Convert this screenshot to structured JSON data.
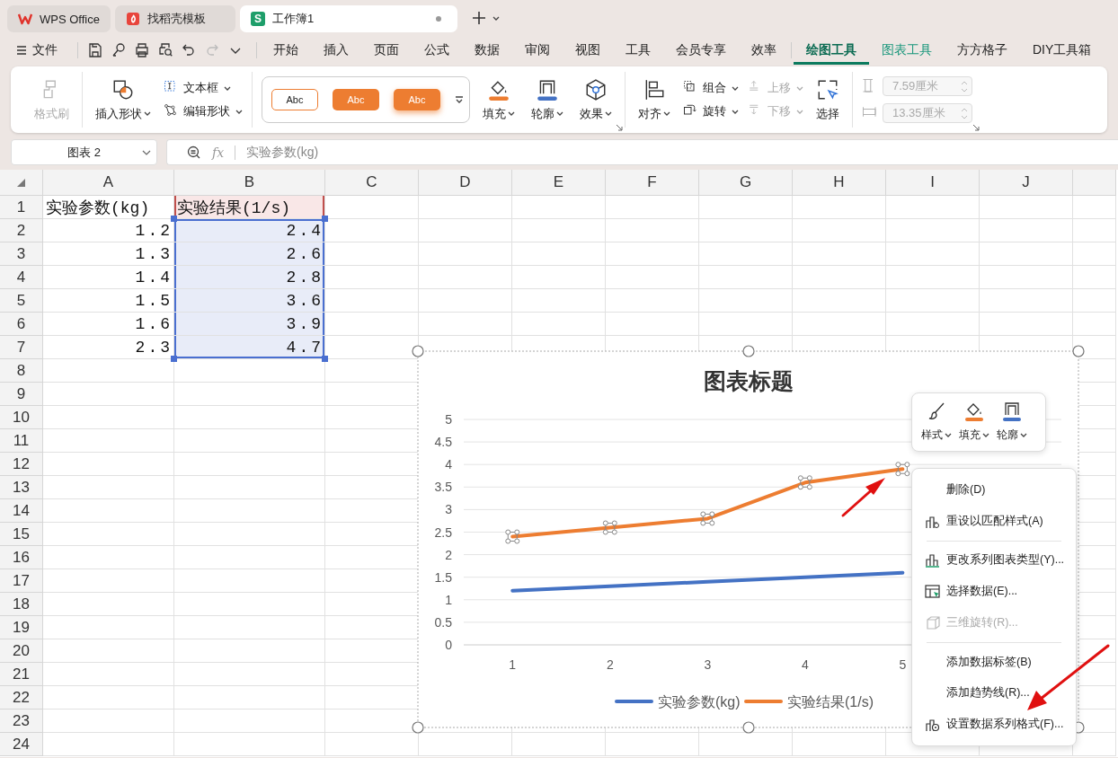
{
  "tabs": [
    {
      "label": "WPS Office",
      "kind": "wps",
      "selected": false
    },
    {
      "label": "找稻壳模板",
      "kind": "docer",
      "selected": false
    },
    {
      "label": "工作簿1",
      "kind": "sheet",
      "badge": "S",
      "selected": true
    }
  ],
  "menu": {
    "file": "文件",
    "items": [
      {
        "label": "开始",
        "kind": "normal",
        "selected": false
      },
      {
        "label": "插入",
        "kind": "normal",
        "selected": false
      },
      {
        "label": "页面",
        "kind": "normal",
        "selected": false
      },
      {
        "label": "公式",
        "kind": "normal",
        "selected": false
      },
      {
        "label": "数据",
        "kind": "normal",
        "selected": false
      },
      {
        "label": "审阅",
        "kind": "normal",
        "selected": false
      },
      {
        "label": "视图",
        "kind": "normal",
        "selected": false
      },
      {
        "label": "工具",
        "kind": "normal",
        "selected": false
      },
      {
        "label": "会员专享",
        "kind": "normal",
        "selected": false
      },
      {
        "label": "效率",
        "kind": "normal",
        "selected": false
      },
      {
        "label": "绘图工具",
        "kind": "context",
        "selected": true
      },
      {
        "label": "图表工具",
        "kind": "context",
        "selected": false
      },
      {
        "label": "方方格子",
        "kind": "normal",
        "selected": false
      },
      {
        "label": "DIY工具箱",
        "kind": "normal",
        "selected": false
      }
    ]
  },
  "ribbon": {
    "groups": [
      {
        "items": [
          {
            "kind": "large",
            "label": "格式刷",
            "dropdown": false,
            "disabled": true
          }
        ]
      },
      {
        "items": [
          {
            "kind": "large",
            "label": "插入形状",
            "dropdown": true,
            "disabled": false
          },
          {
            "kind": "column",
            "items": [
              {
                "label": "文本框",
                "dropdown": true,
                "disabled": false
              },
              {
                "label": "编辑形状",
                "dropdown": true,
                "disabled": false
              }
            ]
          }
        ]
      },
      {
        "launcher": true,
        "items": [
          {
            "kind": "gallery",
            "styles": [
              {
                "label": "Abc",
                "kind": "outline"
              },
              {
                "label": "Abc",
                "kind": "filled"
              },
              {
                "label": "Abc",
                "kind": "shadow"
              }
            ]
          },
          {
            "kind": "large",
            "label": "填充",
            "dropdown": true,
            "disabled": false
          },
          {
            "kind": "large",
            "label": "轮廓",
            "dropdown": true,
            "disabled": false
          },
          {
            "kind": "large",
            "label": "效果",
            "dropdown": true,
            "disabled": false
          }
        ]
      },
      {
        "items": [
          {
            "kind": "large",
            "label": "对齐",
            "dropdown": true,
            "disabled": false
          },
          {
            "kind": "column",
            "items": [
              {
                "label": "组合",
                "dropdown": true,
                "disabled": false
              },
              {
                "label": "旋转",
                "dropdown": true,
                "disabled": false
              }
            ]
          },
          {
            "kind": "column",
            "items": [
              {
                "label": "上移",
                "dropdown": true,
                "disabled": true
              },
              {
                "label": "下移",
                "dropdown": true,
                "disabled": true
              }
            ]
          },
          {
            "kind": "large",
            "label": "选择",
            "dropdown": false,
            "disabled": false
          }
        ]
      },
      {
        "launcher": true,
        "items": [
          {
            "kind": "fields",
            "items": [
              {
                "value": "7.59厘米",
                "disabled": true
              },
              {
                "value": "13.35厘米",
                "disabled": true
              }
            ]
          }
        ]
      }
    ]
  },
  "formula_bar": {
    "name_box": "图表 2",
    "fx": "fx",
    "formula": "实验参数(kg)"
  },
  "sheet": {
    "columns": [
      "A",
      "B",
      "C",
      "D",
      "E",
      "F",
      "G",
      "H",
      "I",
      "J"
    ],
    "row_headers": [
      "1",
      "2",
      "3",
      "4",
      "5",
      "6",
      "7",
      "8",
      "9",
      "10",
      "11",
      "12",
      "13",
      "14",
      "15",
      "16",
      "17",
      "18",
      "19",
      "20",
      "21",
      "22",
      "23",
      "24"
    ],
    "rows": [
      {
        "cells": [
          {
            "text": "实验参数(kg)",
            "kind": "text",
            "in_range": false
          },
          {
            "text": "实验结果(1/s)",
            "kind": "text",
            "in_range": true
          }
        ]
      },
      {
        "cells": [
          {
            "text": "1.2",
            "kind": "number",
            "in_range": false
          },
          {
            "text": "2.4",
            "kind": "number",
            "in_range": true
          }
        ]
      },
      {
        "cells": [
          {
            "text": "1.3",
            "kind": "number",
            "in_range": false
          },
          {
            "text": "2.6",
            "kind": "number",
            "in_range": true
          }
        ]
      },
      {
        "cells": [
          {
            "text": "1.4",
            "kind": "number",
            "in_range": false
          },
          {
            "text": "2.8",
            "kind": "number",
            "in_range": true
          }
        ]
      },
      {
        "cells": [
          {
            "text": "1.5",
            "kind": "number",
            "in_range": false
          },
          {
            "text": "3.6",
            "kind": "number",
            "in_range": true
          }
        ]
      },
      {
        "cells": [
          {
            "text": "1.6",
            "kind": "number",
            "in_range": false
          },
          {
            "text": "3.9",
            "kind": "number",
            "in_range": true
          }
        ]
      },
      {
        "cells": [
          {
            "text": "2.3",
            "kind": "number",
            "in_range": false
          },
          {
            "text": "4.7",
            "kind": "number",
            "in_range": true
          }
        ]
      }
    ]
  },
  "chart": {
    "selected": true,
    "chart_data": {
      "type": "line",
      "title": "图表标题",
      "categories": [
        "1",
        "2",
        "3",
        "4",
        "5"
      ],
      "series": [
        {
          "name": "实验参数(kg)",
          "color": "#4472c4",
          "marker": false,
          "values": [
            1.2,
            1.3,
            1.4,
            1.5,
            1.6
          ]
        },
        {
          "name": "实验结果(1/s)",
          "color": "#ed7d31",
          "marker": true,
          "values": [
            2.4,
            2.6,
            2.8,
            3.6,
            3.9
          ]
        }
      ],
      "ylim": [
        0,
        5
      ],
      "yticks": [
        0,
        0.5,
        1,
        1.5,
        2,
        2.5,
        3,
        3.5,
        4,
        4.5,
        5
      ],
      "grid": true,
      "legend": "bottom"
    }
  },
  "float_toolbar": [
    {
      "label": "样式"
    },
    {
      "label": "填充"
    },
    {
      "label": "轮廓"
    }
  ],
  "context_menu": [
    {
      "kind": "item",
      "label": "删除(D)",
      "disabled": false
    },
    {
      "kind": "item",
      "label": "重设以匹配样式(A)",
      "disabled": false
    },
    {
      "kind": "separator"
    },
    {
      "kind": "item",
      "label": "更改系列图表类型(Y)...",
      "disabled": false
    },
    {
      "kind": "item",
      "label": "选择数据(E)...",
      "disabled": false
    },
    {
      "kind": "item",
      "label": "三维旋转(R)...",
      "disabled": true
    },
    {
      "kind": "separator"
    },
    {
      "kind": "item",
      "label": "添加数据标签(B)",
      "disabled": false
    },
    {
      "kind": "item",
      "label": "添加趋势线(R)...",
      "disabled": false
    },
    {
      "kind": "item",
      "label": "设置数据系列格式(F)...",
      "disabled": false
    }
  ],
  "annotations": [
    {
      "kind": "arrow_up_right"
    },
    {
      "kind": "arrow_down_left"
    }
  ]
}
